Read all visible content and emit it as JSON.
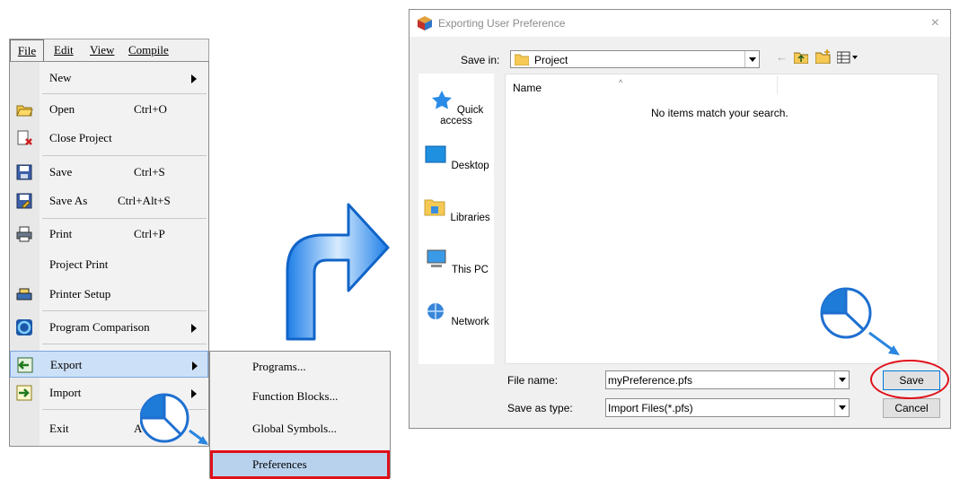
{
  "menubar": {
    "file": "File",
    "edit": "Edit",
    "view": "View",
    "compile": "Compile"
  },
  "file_menu": {
    "new": "New",
    "open": "Open",
    "open_sc": "Ctrl+O",
    "close_project": "Close Project",
    "save": "Save",
    "save_sc": "Ctrl+S",
    "save_as": "Save As",
    "save_as_sc": "Ctrl+Alt+S",
    "print": "Print",
    "print_sc": "Ctrl+P",
    "project_print": "Project Print",
    "printer_setup": "Printer Setup",
    "program_comparison": "Program Comparison",
    "export": "Export",
    "import": "Import",
    "exit": "Exit",
    "exit_sc": "A"
  },
  "export_submenu": {
    "programs": "Programs...",
    "function_blocks": "Function Blocks...",
    "global_symbols": "Global Symbols...",
    "preferences": "Preferences"
  },
  "dialog": {
    "title": "Exporting User Preference",
    "close": "×",
    "save_in_label": "Save in:",
    "save_in_value": "Project",
    "column_name": "Name",
    "empty_message": "No items match your search.",
    "places": [
      "Quick access",
      "Desktop",
      "Libraries",
      "This PC",
      "Network"
    ],
    "file_name_label": "File name:",
    "file_name_value": "myPreference.pfs",
    "save_as_type_label": "Save as type:",
    "save_as_type_value": "Import Files(*.pfs)",
    "save_button": "Save",
    "cancel_button": "Cancel"
  },
  "colors": {
    "highlight": "#cce0f7",
    "accent_red": "#e0101a",
    "arrow_blue": "#1e90ff",
    "pie_blue": "#1e7bd8"
  }
}
